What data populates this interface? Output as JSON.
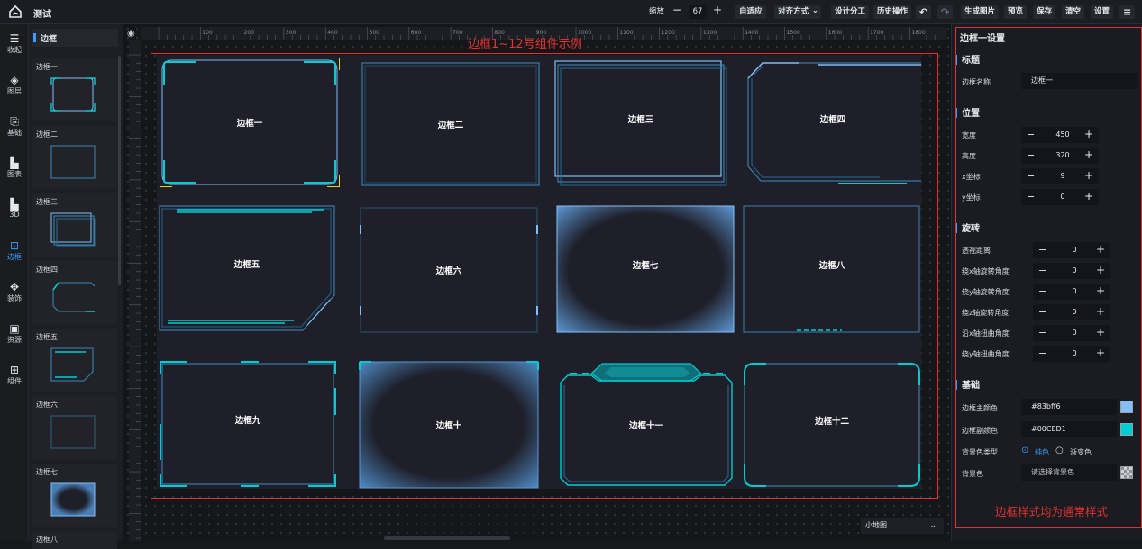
{
  "app": {
    "title": "测试"
  },
  "toolbar": {
    "zoom_label": "缩放",
    "zoom_value": "67",
    "fit": "自适应",
    "align": "对齐方式",
    "design": "设计分工",
    "history": "历史操作",
    "gen_image": "生成图片",
    "preview": "预览",
    "save": "保存",
    "clear": "清空",
    "settings": "设置"
  },
  "sidebar": {
    "items": [
      {
        "label": "收起",
        "icon": "collapse-icon"
      },
      {
        "label": "图层",
        "icon": "layers-icon"
      },
      {
        "label": "基础",
        "icon": "basic-icon"
      },
      {
        "label": "图表",
        "icon": "chart-icon"
      },
      {
        "label": "3D",
        "icon": "3d-icon"
      },
      {
        "label": "边框",
        "icon": "border-icon",
        "active": true
      },
      {
        "label": "装饰",
        "icon": "decoration-icon"
      },
      {
        "label": "资源",
        "icon": "resource-icon"
      },
      {
        "label": "组件",
        "icon": "component-icon"
      }
    ]
  },
  "component_list": {
    "title": "边框",
    "items": [
      "边框一",
      "边框二",
      "边框三",
      "边框四",
      "边框五",
      "边框六",
      "边框七",
      "边框八"
    ]
  },
  "canvas": {
    "annotation": "边框1~12号组件示例",
    "ruler_ticks": [
      "100",
      "200",
      "300",
      "400",
      "500",
      "600",
      "700",
      "800",
      "900",
      "1000",
      "1100",
      "1200",
      "1300",
      "1400",
      "1500",
      "1600",
      "1700",
      "1800",
      "1900"
    ],
    "borders": [
      "边框一",
      "边框二",
      "边框三",
      "边框四",
      "边框五",
      "边框六",
      "边框七",
      "边框八",
      "边框九",
      "边框十",
      "边框十一",
      "边框十二"
    ],
    "minimap": "小地图"
  },
  "panel": {
    "title": "边框一设置",
    "sections": {
      "title": "标题",
      "position": "位置",
      "rotation": "旋转",
      "basic": "基础"
    },
    "name": {
      "label": "边框名称",
      "value": "边框一"
    },
    "position": [
      {
        "label": "宽度",
        "value": "450"
      },
      {
        "label": "高度",
        "value": "320"
      },
      {
        "label": "x坐标",
        "value": "9"
      },
      {
        "label": "y坐标",
        "value": "0"
      }
    ],
    "rotation": [
      {
        "label": "透视距离",
        "value": "0"
      },
      {
        "label": "绕x轴旋转角度",
        "value": "0"
      },
      {
        "label": "绕y轴旋转角度",
        "value": "0"
      },
      {
        "label": "绕z轴旋转角度",
        "value": "0"
      },
      {
        "label": "沿x轴扭曲角度",
        "value": "0"
      },
      {
        "label": "绕y轴扭曲角度",
        "value": "0"
      }
    ],
    "basic": {
      "main_color_label": "边框主颜色",
      "main_color": "#83bff6",
      "sub_color_label": "边框副颜色",
      "sub_color": "#00CED1",
      "bg_type_label": "背景色类型",
      "bg_solid": "纯色",
      "bg_gradient": "渐变色",
      "bg_color_label": "背景色",
      "bg_color_placeholder": "请选择背景色"
    },
    "note": "边框样式均为通常样式"
  },
  "colors": {
    "accent": "#3b9cff",
    "annotation_red": "#e03030",
    "border_main": "#83bff6",
    "border_sub": "#00CED1"
  }
}
